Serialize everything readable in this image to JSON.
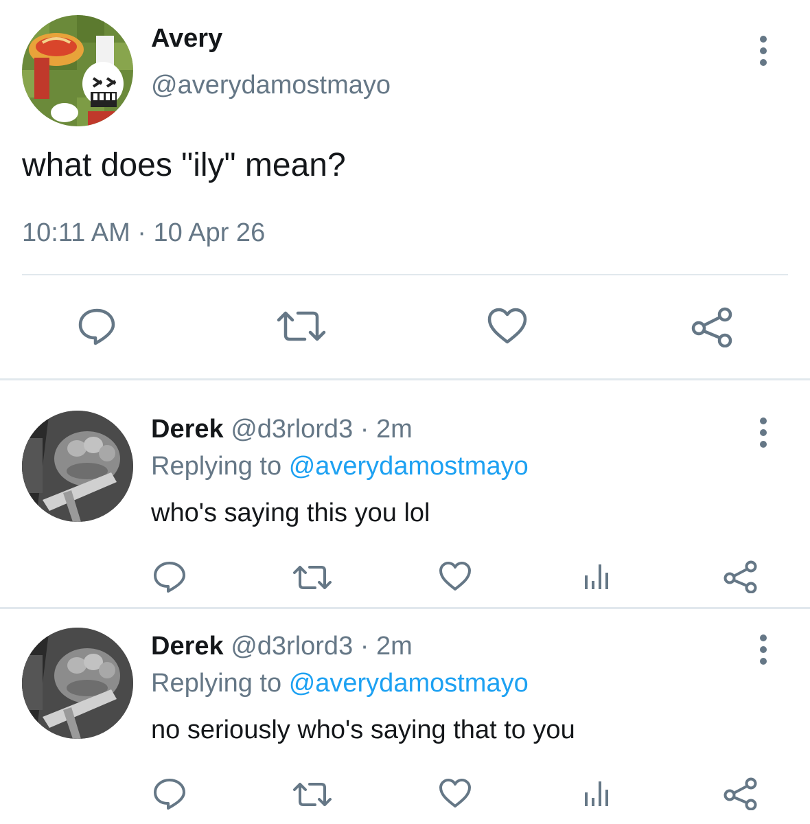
{
  "main_tweet": {
    "author_name": "Avery",
    "author_handle": "@averydamostmayo",
    "text": "what does \"ily\" mean?",
    "time": "10:11 AM",
    "separator": "·",
    "date": "10 Apr 26",
    "actions": [
      "reply-icon",
      "retweet-icon",
      "like-icon",
      "share-icon"
    ]
  },
  "replies": [
    {
      "author_name": "Derek",
      "author_handle": "@d3rlord3",
      "separator": "·",
      "age": "2m",
      "replying_label": "Replying to",
      "replying_to": "@averydamostmayo",
      "text": "who's saying this you lol",
      "actions": [
        "reply-icon",
        "retweet-icon",
        "like-icon",
        "analytics-icon",
        "share-icon"
      ]
    },
    {
      "author_name": "Derek",
      "author_handle": "@d3rlord3",
      "separator": "·",
      "age": "2m",
      "replying_label": "Replying to",
      "replying_to": "@averydamostmayo",
      "text": "no seriously who's saying that to you",
      "actions": [
        "reply-icon",
        "retweet-icon",
        "like-icon",
        "analytics-icon",
        "share-icon"
      ]
    }
  ],
  "colors": {
    "text_primary": "#14171a",
    "text_secondary": "#657786",
    "link": "#1da1f2",
    "divider": "#e1e8ed",
    "icon": "#657786"
  }
}
